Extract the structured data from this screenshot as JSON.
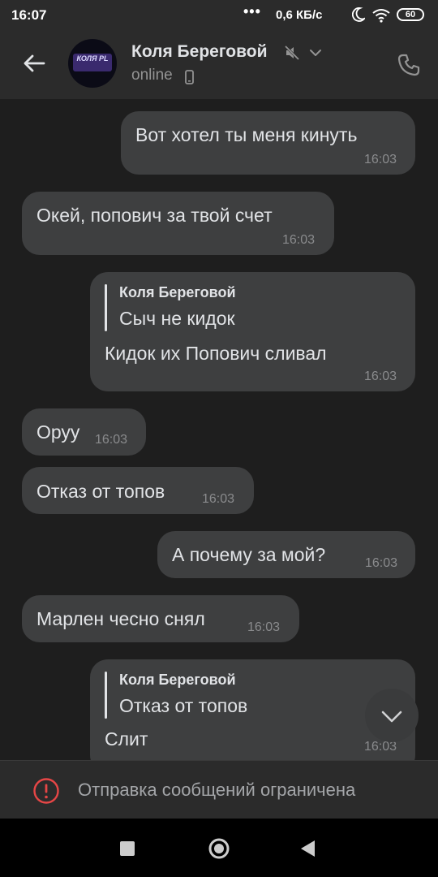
{
  "status_bar": {
    "time": "16:07",
    "dots": "•••",
    "speed": "0,6 КБ/с",
    "battery": "60"
  },
  "header": {
    "contact_name": "Коля Береговой",
    "status": "online",
    "avatar_text": "КОЛЯ PL"
  },
  "messages": [
    {
      "id": "m1",
      "direction": "outgoing",
      "text": "Вот хотел ты меня кинуть",
      "time": "16:03"
    },
    {
      "id": "m2",
      "direction": "incoming",
      "text": "Окей, попович за твой счет",
      "time": "16:03"
    },
    {
      "id": "m3",
      "direction": "outgoing",
      "reply": {
        "author": "Коля Береговой",
        "text": "Сыч не кидок"
      },
      "text": "Кидок их Попович сливал",
      "time": "16:03"
    },
    {
      "id": "m4",
      "direction": "incoming",
      "text": "Оруу",
      "time": "16:03"
    },
    {
      "id": "m5",
      "direction": "incoming",
      "text": "Отказ от топов",
      "time": "16:03"
    },
    {
      "id": "m6",
      "direction": "outgoing",
      "text": "А почему за мой?",
      "time": "16:03"
    },
    {
      "id": "m7",
      "direction": "incoming",
      "text": "Марлен чесно снял",
      "time": "16:03"
    },
    {
      "id": "m8",
      "direction": "outgoing",
      "reply": {
        "author": "Коля Береговой",
        "text": "Отказ от топов"
      },
      "text": "Слит",
      "time": "16:03"
    }
  ],
  "restriction": {
    "text": "Отправка сообщений ограничена"
  },
  "colors": {
    "background": "#1e1e1e",
    "bubble": "#3e3f40",
    "header": "#2b2b2b",
    "text": "#e1e3e6",
    "secondary_text": "#8a8b8d",
    "error_icon": "#e64646"
  }
}
